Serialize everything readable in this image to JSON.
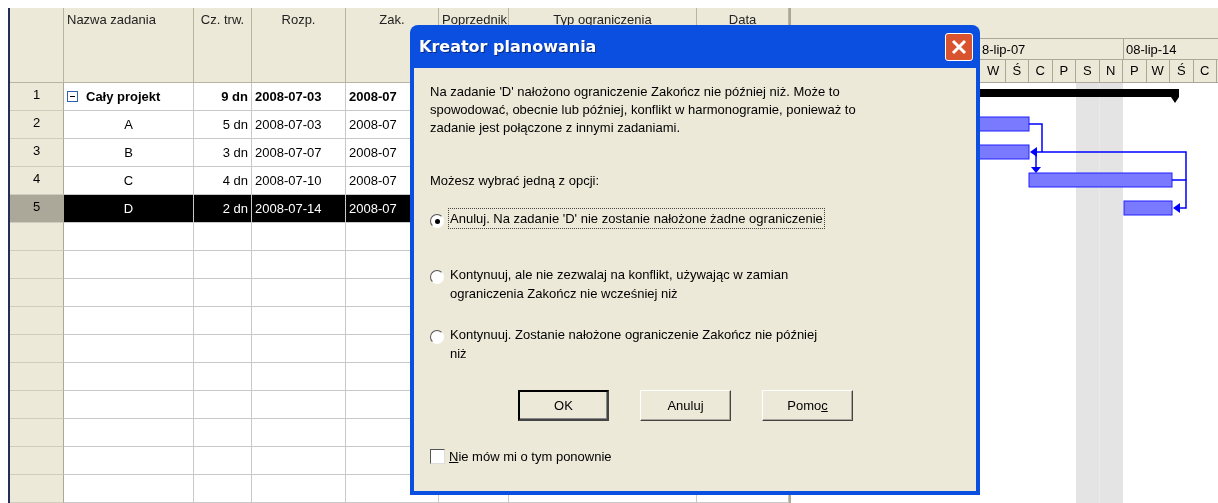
{
  "table": {
    "columns": [
      "Nazwa zadania",
      "Cz. trw.",
      "Rozp.",
      "Zak.",
      "Poprzednik",
      "Typ ograniczenia",
      "Data"
    ],
    "rows": [
      {
        "id": "1",
        "name": "Cały projekt",
        "duration": "9 dn",
        "start": "2008-07-03",
        "finish": "2008-07",
        "summary": true,
        "expanded": true,
        "selected": false
      },
      {
        "id": "2",
        "name": "A",
        "duration": "5 dn",
        "start": "2008-07-03",
        "finish": "2008-07",
        "summary": false,
        "selected": false
      },
      {
        "id": "3",
        "name": "B",
        "duration": "3 dn",
        "start": "2008-07-07",
        "finish": "2008-07",
        "summary": false,
        "selected": false
      },
      {
        "id": "4",
        "name": "C",
        "duration": "4 dn",
        "start": "2008-07-10",
        "finish": "2008-07",
        "summary": false,
        "selected": false
      },
      {
        "id": "5",
        "name": "D",
        "duration": "2 dn",
        "start": "2008-07-14",
        "finish": "2008-07",
        "summary": false,
        "selected": true
      }
    ]
  },
  "gantt": {
    "weeks": [
      "8-lip-07",
      "08-lip-14"
    ],
    "days": [
      {
        "label": "W",
        "weekend": false
      },
      {
        "label": "Ś",
        "weekend": false
      },
      {
        "label": "C",
        "weekend": false
      },
      {
        "label": "P",
        "weekend": false
      },
      {
        "label": "S",
        "weekend": true
      },
      {
        "label": "N",
        "weekend": true
      },
      {
        "label": "P",
        "weekend": false
      },
      {
        "label": "W",
        "weekend": false
      },
      {
        "label": "Ś",
        "weekend": false
      },
      {
        "label": "C",
        "weekend": false
      }
    ]
  },
  "dialog": {
    "title": "Kreator planowania",
    "message": "Na zadanie 'D' nałożono ograniczenie Zakończ nie później niż. Może to spowodować, obecnie lub później, konflikt w harmonogramie, ponieważ to zadanie jest połączone z innymi zadaniami.",
    "prompt": "Możesz wybrać jedną z opcji:",
    "options": [
      {
        "label": "Anuluj. Na zadanie 'D' nie zostanie nałożone żadne ograniczenie",
        "selected": true
      },
      {
        "label": "Kontynuuj, ale nie zezwalaj na konflikt, używając w zamian ograniczenia Zakończ nie wcześniej niż",
        "selected": false
      },
      {
        "label": "Kontynuuj. Zostanie nałożone ograniczenie Zakończ nie później niż",
        "selected": false
      }
    ],
    "buttons": [
      {
        "label": "OK",
        "default": true
      },
      {
        "label": "Anuluj",
        "default": false
      },
      {
        "label": "Pomo",
        "access_key": "c",
        "default": false
      }
    ],
    "dont_show": {
      "access_key": "N",
      "label_rest": "ie mów mi o tym ponownie",
      "checked": false
    }
  }
}
